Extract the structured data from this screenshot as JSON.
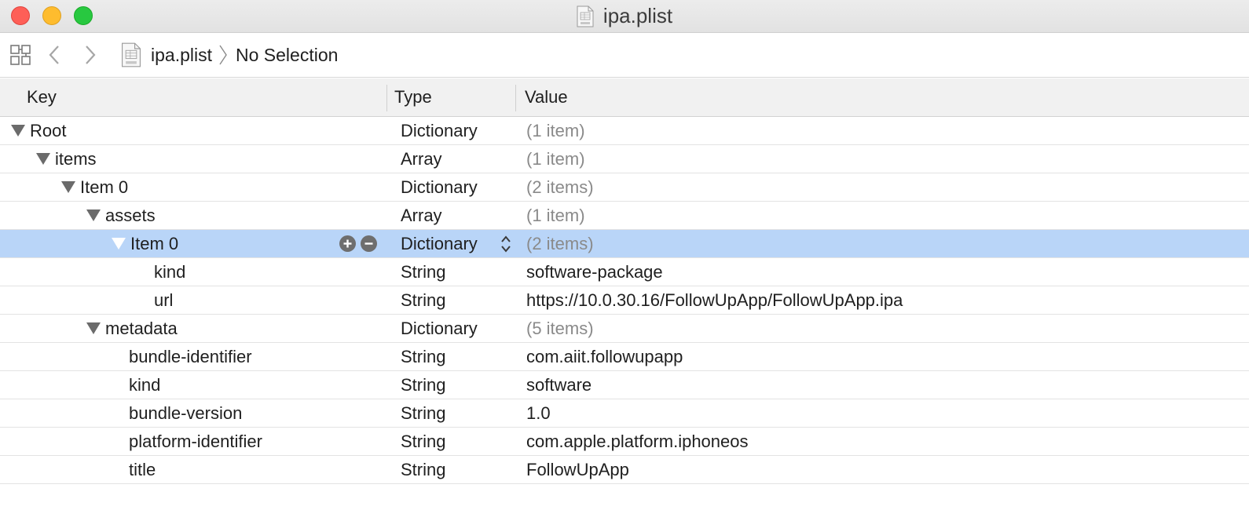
{
  "window": {
    "title": "ipa.plist"
  },
  "jumpbar": {
    "file_label": "ipa.plist",
    "breadcrumb": "No Selection"
  },
  "columns": {
    "key": "Key",
    "type": "Type",
    "value": "Value"
  },
  "rows": [
    {
      "key": "Root",
      "type": "Dictionary",
      "value": "(1 item)",
      "expanded": true
    },
    {
      "key": "items",
      "type": "Array",
      "value": "(1 item)",
      "expanded": true
    },
    {
      "key": "Item 0",
      "type": "Dictionary",
      "value": "(2 items)",
      "expanded": true
    },
    {
      "key": "assets",
      "type": "Array",
      "value": "(1 item)",
      "expanded": true
    },
    {
      "key": "Item 0",
      "type": "Dictionary",
      "value": "(2 items)",
      "expanded": true,
      "selected": true
    },
    {
      "key": "kind",
      "type": "String",
      "value": "software-package"
    },
    {
      "key": "url",
      "type": "String",
      "value": "https://10.0.30.16/FollowUpApp/FollowUpApp.ipa"
    },
    {
      "key": "metadata",
      "type": "Dictionary",
      "value": "(5 items)",
      "expanded": true
    },
    {
      "key": "bundle-identifier",
      "type": "String",
      "value": "com.aiit.followupapp"
    },
    {
      "key": "kind",
      "type": "String",
      "value": "software"
    },
    {
      "key": "bundle-version",
      "type": "String",
      "value": "1.0"
    },
    {
      "key": "platform-identifier",
      "type": "String",
      "value": "com.apple.platform.iphoneos"
    },
    {
      "key": "title",
      "type": "String",
      "value": "FollowUpApp"
    }
  ],
  "icons": {
    "close": "close-button",
    "minimize": "minimize-button",
    "zoom": "zoom-button",
    "grid": "related-items-icon",
    "back": "chevron-left-icon",
    "forward": "chevron-right-icon",
    "file": "plist-file-icon",
    "add": "plus-circle-icon",
    "remove": "minus-circle-icon",
    "stepper": "up-down-chevron-icon"
  },
  "colors": {
    "selection": "#b9d5f8",
    "muted_text": "#8a8a8a",
    "close": "#fe5f57",
    "minimize": "#febc2e",
    "zoom": "#28c840"
  }
}
